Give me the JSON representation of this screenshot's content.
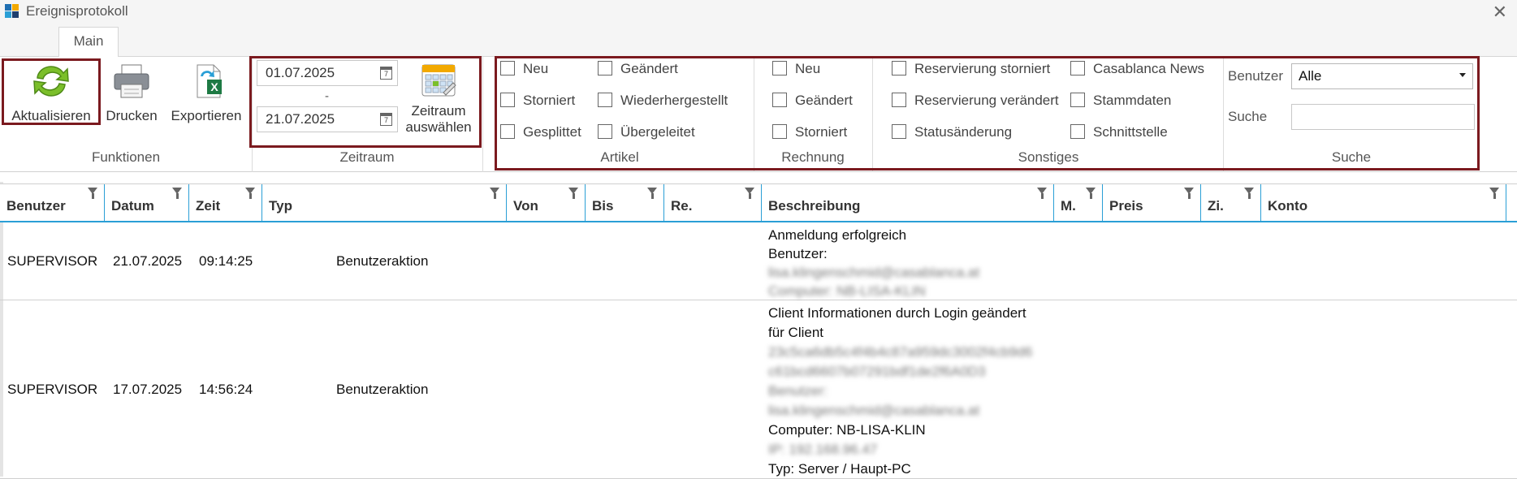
{
  "window": {
    "title": "Ereignisprotokoll",
    "close_glyph": "✕"
  },
  "tabs": [
    {
      "label": "Main",
      "active": true
    }
  ],
  "ribbon": {
    "functions": {
      "label": "Funktionen",
      "refresh": "Aktualisieren",
      "print": "Drucken",
      "export": "Exportieren"
    },
    "period": {
      "label": "Zeitraum",
      "from": "01.07.2025",
      "separator": "-",
      "to": "21.07.2025",
      "select_line1": "Zeitraum",
      "select_line2": "auswählen"
    },
    "article": {
      "label": "Artikel",
      "items": [
        "Neu",
        "Geändert",
        "Storniert",
        "Wiederhergestellt",
        "Gesplittet",
        "Übergeleitet"
      ]
    },
    "invoice": {
      "label": "Rechnung",
      "items": [
        "Neu",
        "Geändert",
        "Storniert"
      ]
    },
    "misc": {
      "label": "Sonstiges",
      "items": [
        "Reservierung storniert",
        "Casablanca News",
        "Reservierung verändert",
        "Stammdaten",
        "Statusänderung",
        "Schnittstelle"
      ]
    },
    "search": {
      "label": "Suche",
      "user_label": "Benutzer",
      "user_value": "Alle",
      "search_label": "Suche",
      "search_value": ""
    }
  },
  "grid": {
    "columns": [
      "Benutzer",
      "Datum",
      "Zeit",
      "Typ",
      "Von",
      "Bis",
      "Re.",
      "Beschreibung",
      "M.",
      "Preis",
      "Zi.",
      "Konto"
    ],
    "rows": [
      {
        "user": "SUPERVISOR",
        "date": "21.07.2025",
        "time": "09:14:25",
        "type": "Benutzeraktion",
        "desc": [
          {
            "text": "Anmeldung erfolgreich",
            "blurred": false
          },
          {
            "text": "Benutzer:",
            "blurred": false
          },
          {
            "text": "lisa.klingenschmid@casablanca.at",
            "blurred": true
          },
          {
            "text": "Computer: NB-LISA-KLIN",
            "blurred": true
          }
        ]
      },
      {
        "user": "SUPERVISOR",
        "date": "17.07.2025",
        "time": "14:56:24",
        "type": "Benutzeraktion",
        "desc": [
          {
            "text": "Client Informationen durch Login geändert",
            "blurred": false
          },
          {
            "text": "für Client",
            "blurred": false
          },
          {
            "text": "23c5ca6db5c4f4b4c87a959dc3002f4cb9d6",
            "blurred": true
          },
          {
            "text": "c61bcd6607b07291bdf1de2f6A0D3",
            "blurred": true
          },
          {
            "text": "Benutzer:",
            "blurred": true
          },
          {
            "text": "lisa.klingenschmid@casablanca.at",
            "blurred": true
          },
          {
            "text": "Computer: NB-LISA-KLIN",
            "blurred": false
          },
          {
            "text": "IP: 192.168.96.47",
            "blurred": true
          },
          {
            "text": "Typ: Server / Haupt-PC",
            "blurred": false
          }
        ]
      }
    ]
  },
  "colors": {
    "accent": "#2a9fd6",
    "highlight_box": "#7b1a1f",
    "refresh_green": "#7bbf2a"
  },
  "icons": {
    "refresh": "refresh-icon",
    "print": "printer-icon",
    "export": "excel-export-icon",
    "calendar": "calendar-icon",
    "filter": "filter-icon"
  }
}
